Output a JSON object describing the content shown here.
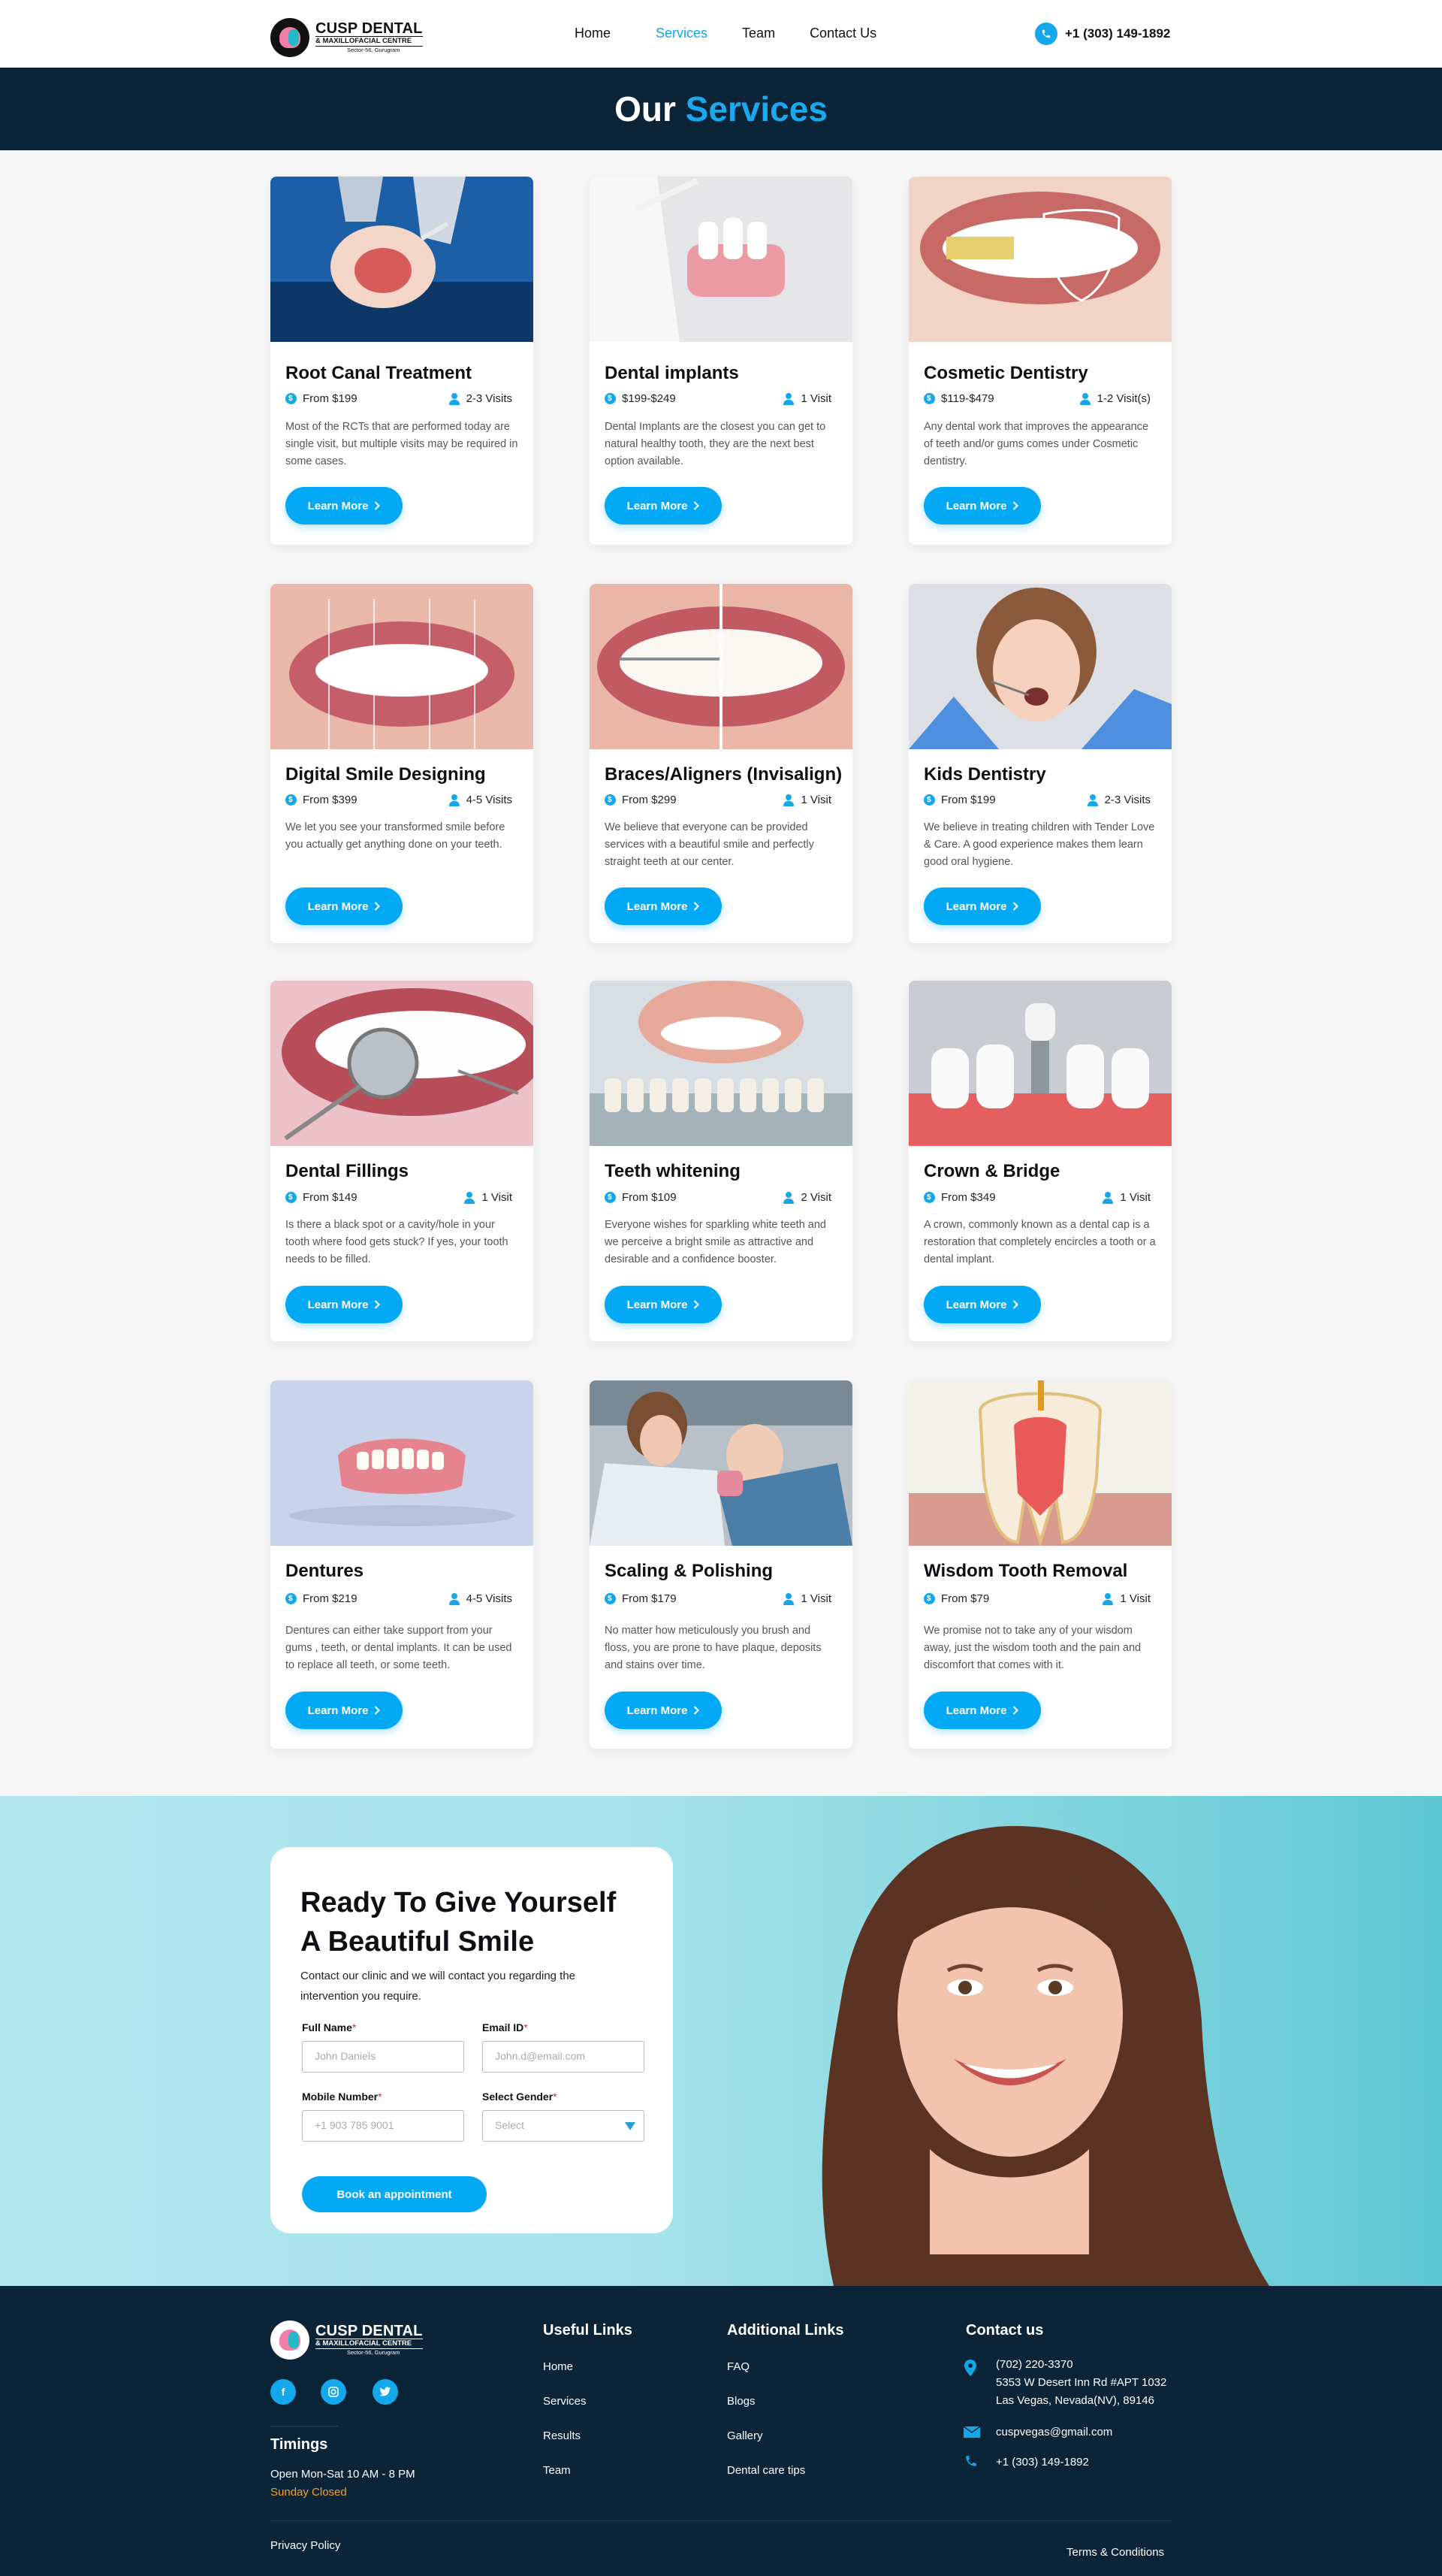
{
  "header": {
    "logo_line1": "CUSP DENTAL",
    "logo_line2": "& MAXILLOFACIAL CENTRE",
    "logo_line3": "Sector-56, Gurugram",
    "nav": [
      "Home",
      "Services",
      "Team",
      "Contact Us"
    ],
    "active_nav": "Services",
    "phone": "+1 (303) 149-1892"
  },
  "banner": {
    "title_part1": "Our ",
    "title_part2": "Services"
  },
  "learn_more": "Learn More",
  "services": [
    {
      "title": "Root Canal Treatment",
      "price": "From $199",
      "visits": "2-3 Visits",
      "desc": "Most of the RCTs that are performed today are single visit, but multiple visits may be required in some cases."
    },
    {
      "title": "Dental implants",
      "price": "$199-$249",
      "visits": "1 Visit",
      "desc": "Dental Implants are the closest you can get to natural healthy tooth, they are the next best option available."
    },
    {
      "title": "Cosmetic Dentistry",
      "price": "$119-$479",
      "visits": "1-2 Visit(s)",
      "desc": "Any dental work that improves the appearance of teeth and/or gums comes under Cosmetic dentistry."
    },
    {
      "title": "Digital Smile Designing",
      "price": "From $399",
      "visits": "4-5 Visits",
      "desc": "We let you see your transformed smile before you actually get anything done on your teeth."
    },
    {
      "title": "Braces/Aligners (Invisalign)",
      "price": "From $299",
      "visits": "1 Visit",
      "desc": "We believe that everyone can be provided services with a beautiful smile and perfectly straight teeth at our center."
    },
    {
      "title": "Kids Dentistry",
      "price": "From $199",
      "visits": "2-3 Visits",
      "desc": "We believe in treating children with Tender Love & Care. A good experience makes them learn good oral hygiene."
    },
    {
      "title": "Dental Fillings",
      "price": "From $149",
      "visits": "1 Visit",
      "desc": "Is there a black spot or a cavity/hole in your tooth where food gets stuck? If yes, your tooth needs to be filled."
    },
    {
      "title": "Teeth whitening",
      "price": "From $109",
      "visits": "2 Visit",
      "desc": "Everyone wishes for sparkling white teeth and we perceive a bright smile as attractive and desirable and a confidence booster."
    },
    {
      "title": "Crown & Bridge",
      "price": "From $349",
      "visits": "1 Visit",
      "desc": "A crown, commonly known as a dental cap is a restoration that completely encircles a tooth or a dental implant."
    },
    {
      "title": "Dentures",
      "price": "From $219",
      "visits": "4-5 Visits",
      "desc": "Dentures can either take support from your gums , teeth, or dental implants. It can be used to replace all teeth, or some teeth."
    },
    {
      "title": "Scaling & Polishing",
      "price": "From $179",
      "visits": "1 Visit",
      "desc": "No matter how meticulously you brush and floss, you are prone to have plaque, deposits and stains over time."
    },
    {
      "title": "Wisdom Tooth Removal",
      "price": "From $79",
      "visits": "1 Visit",
      "desc": "We promise not to take any of your wisdom away, just the wisdom tooth and the pain and discomfort that comes with it."
    }
  ],
  "appointment": {
    "heading_line1": "Ready To Give Yourself",
    "heading_line2": "A Beautiful Smile",
    "sub": "Contact our clinic and we will contact you regarding the intervention you require.",
    "full_name_label": "Full Name",
    "full_name_placeholder": "John Daniels",
    "email_label": "Email ID",
    "email_placeholder": "John.d@email.com",
    "mobile_label": "Mobile Number",
    "mobile_placeholder": "+1 903 785 9001",
    "gender_label": "Select Gender",
    "gender_placeholder": "Select",
    "required_mark": "*",
    "book_button": "Book an appointment"
  },
  "footer": {
    "timings_title": "Timings",
    "timings_text": "Open Mon-Sat 10 AM - 8 PM",
    "closed_text": "Sunday Closed",
    "useful_title": "Useful Links",
    "useful_links": [
      "Home",
      "Services",
      "Results",
      "Team"
    ],
    "additional_title": "Additional Links",
    "additional_links": [
      "FAQ",
      "Blogs",
      "Gallery",
      "Dental care tips"
    ],
    "contact_title": "Contact us",
    "contact_phone1": "(702) 220-3370",
    "contact_address1": "5353 W Desert Inn Rd #APT 1032",
    "contact_address2": "Las Vegas, Nevada(NV), 89146",
    "contact_email": "cuspvegas@gmail.com",
    "contact_phone2": "+1 (303) 149-1892",
    "privacy": "Privacy Policy",
    "terms": "Terms & Conditions"
  },
  "colors": {
    "accent": "#03a9f4",
    "navy": "#0c2438",
    "closed": "#f0a030"
  }
}
